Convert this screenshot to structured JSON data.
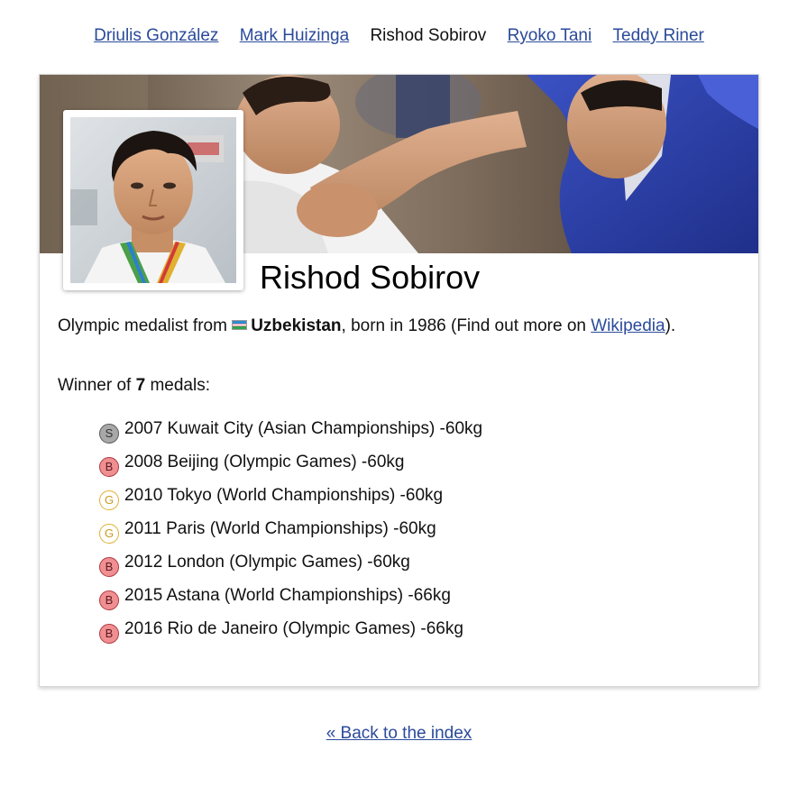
{
  "nav": {
    "links": [
      "Driulis González",
      "Mark Huizinga"
    ],
    "current": "Rishod Sobirov",
    "links_after": [
      "Ryoko Tani",
      "Teddy Riner"
    ]
  },
  "athlete": {
    "name": "Rishod Sobirov",
    "bio_prefix": "Olympic medalist from",
    "country": "Uzbekistan",
    "bio_born": ", born in 1986 (Find out more on ",
    "wiki_label": "Wikipedia",
    "bio_suffix": ")."
  },
  "summary": {
    "prefix": "Winner of ",
    "count": "7",
    "suffix": " medals:"
  },
  "medals": [
    {
      "type": "S",
      "text": "2007 Kuwait City (Asian Championships) -60kg"
    },
    {
      "type": "B",
      "text": "2008 Beijing (Olympic Games) -60kg"
    },
    {
      "type": "G",
      "text": "2010 Tokyo (World Championships) -60kg"
    },
    {
      "type": "G",
      "text": "2011 Paris (World Championships) -60kg"
    },
    {
      "type": "B",
      "text": "2012 London (Olympic Games) -60kg"
    },
    {
      "type": "B",
      "text": "2015 Astana (World Championships) -66kg"
    },
    {
      "type": "B",
      "text": "2016 Rio de Janeiro (Olympic Games) -66kg"
    }
  ],
  "footer": {
    "back_label": "« Back to the index"
  },
  "icons": {
    "flag": "uzbekistan-flag-icon",
    "medal": "medal-badge-icon"
  },
  "colors": {
    "link": "#2a4a9a",
    "silver": "#a8a8a8",
    "bronze": "#f08f92",
    "gold": "#e0b034"
  }
}
